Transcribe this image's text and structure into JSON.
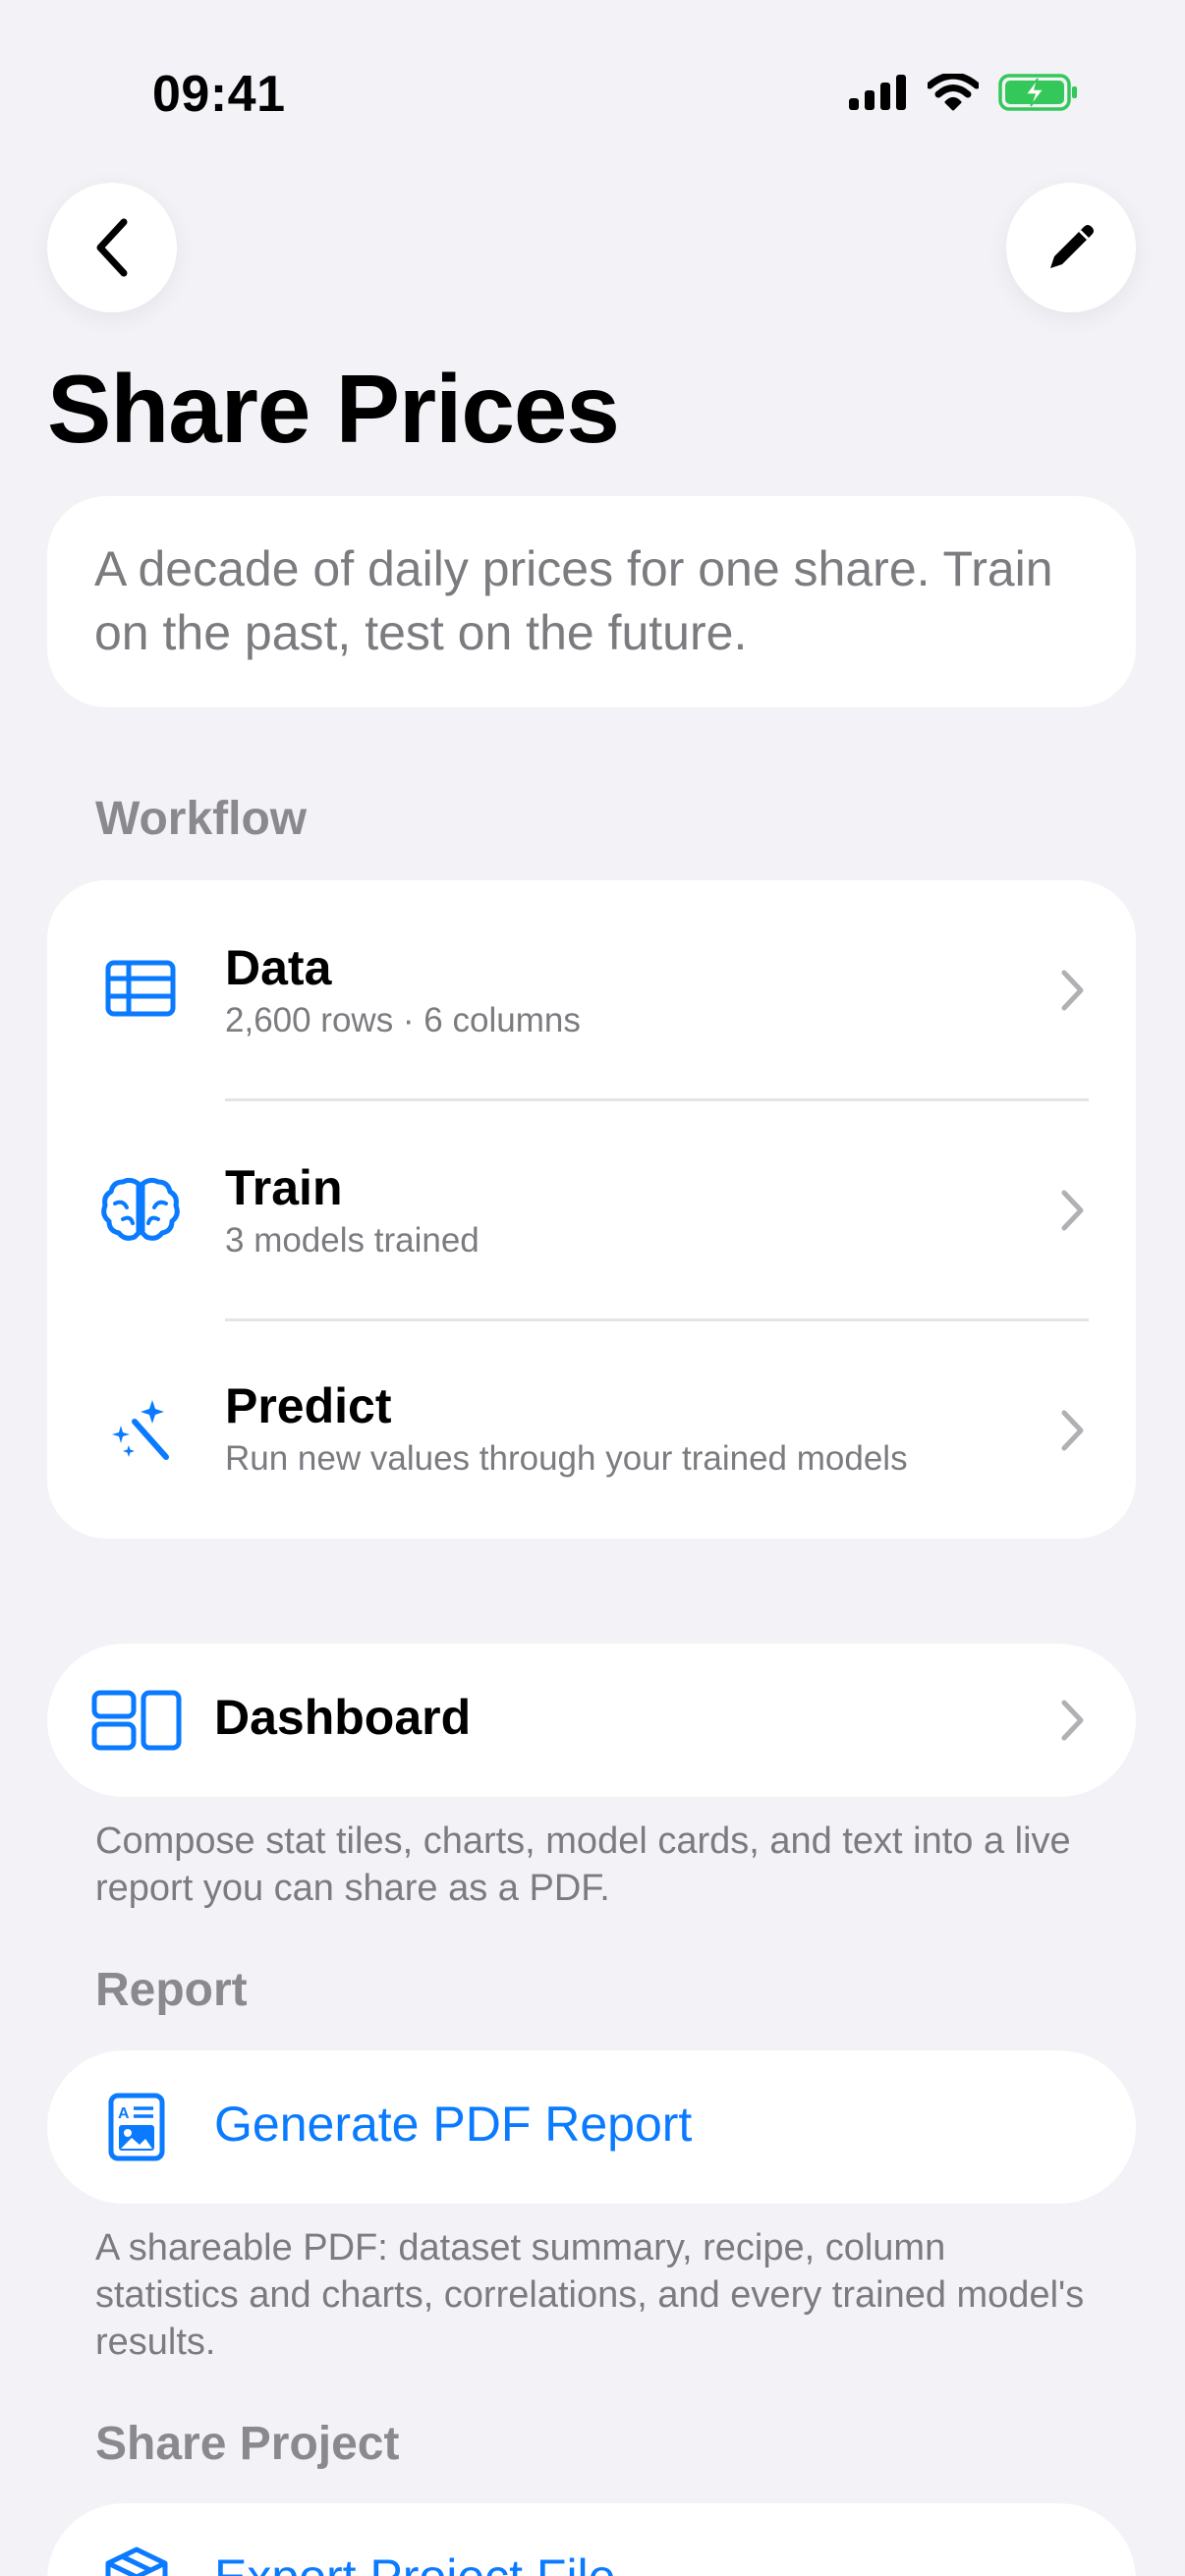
{
  "status_bar": {
    "time": "09:41",
    "icons": [
      "signal-icon",
      "wifi-icon",
      "battery-charging-icon"
    ]
  },
  "nav": {
    "back_icon": "chevron-left-icon",
    "edit_icon": "pencil-icon"
  },
  "page": {
    "title": "Share Prices",
    "description": "A decade of daily prices for one share. Train on the past, test on the future."
  },
  "workflow": {
    "header": "Workflow",
    "items": [
      {
        "icon": "table-icon",
        "title": "Data",
        "subtitle": "2,600 rows · 6 columns"
      },
      {
        "icon": "brain-icon",
        "title": "Train",
        "subtitle": "3 models trained"
      },
      {
        "icon": "magic-wand-icon",
        "title": "Predict",
        "subtitle": "Run new values through your trained models"
      }
    ]
  },
  "dashboard": {
    "icon": "dashboard-layout-icon",
    "label": "Dashboard",
    "footnote": "Compose stat tiles, charts, model cards, and text into a live report you can share as a PDF."
  },
  "report": {
    "header": "Report",
    "icon": "document-image-icon",
    "label": "Generate PDF Report",
    "footnote": "A shareable PDF: dataset summary, recipe, column statistics and charts, correlations, and every trained model's results."
  },
  "share": {
    "header": "Share Project",
    "icon": "box-icon",
    "label": "Export Project File"
  },
  "colors": {
    "accent": "#0a7aff",
    "background": "#f2f2f7",
    "secondary_text": "#7b7b80",
    "battery": "#34c759"
  }
}
